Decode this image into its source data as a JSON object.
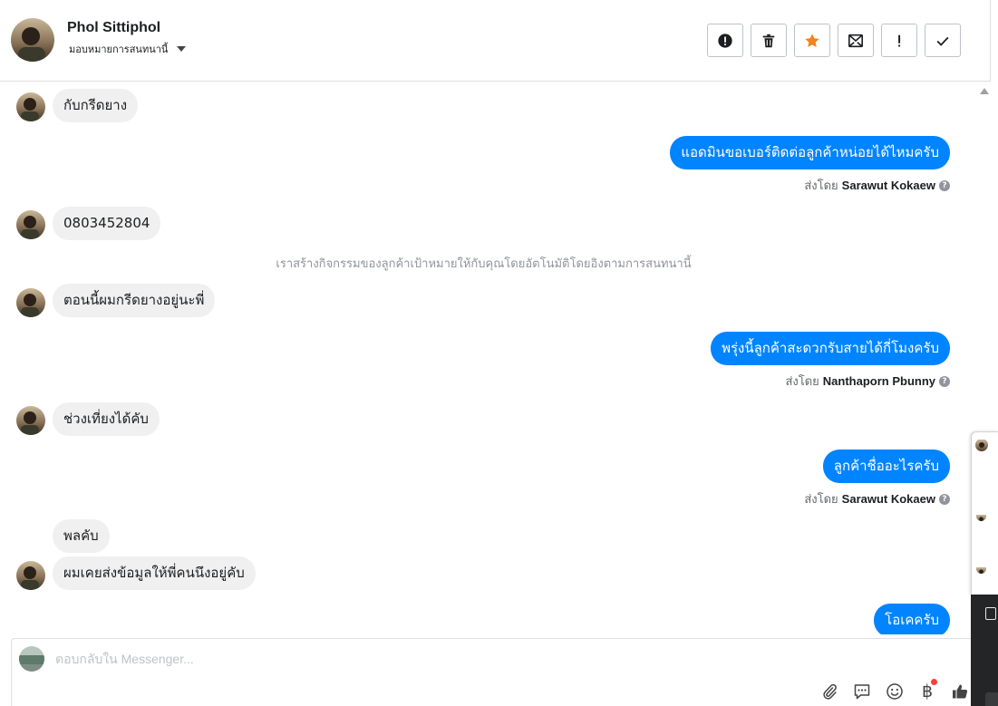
{
  "header": {
    "name": "Phol Sittiphol",
    "assign_label": "มอบหมายการสนทนานี้"
  },
  "toolbar": {
    "buttons": [
      {
        "name": "spam-button",
        "icon": "alert-circle-icon"
      },
      {
        "name": "delete-button",
        "icon": "trash-icon"
      },
      {
        "name": "star-button",
        "icon": "star-icon",
        "color": "#f5821f"
      },
      {
        "name": "mark-unread-button",
        "icon": "mail-icon"
      },
      {
        "name": "follow-up-button",
        "icon": "exclamation-icon"
      },
      {
        "name": "done-button",
        "icon": "check-icon"
      }
    ]
  },
  "messages": [
    {
      "from": "customer",
      "text": "กับกรีดยาง"
    },
    {
      "from": "page",
      "text": "แอดมินขอเบอร์ติดต่อลูกค้าหน่อยได้ไหมครับ",
      "sent_by_label": "ส่งโดย",
      "sender": "Sarawut Kokaew"
    },
    {
      "from": "customer",
      "text": "0803452804"
    },
    {
      "from": "system",
      "text": "เราสร้างกิจกรรมของลูกค้าเป้าหมายให้กับคุณโดยอัตโนมัติโดยอิงตามการสนทนานี้"
    },
    {
      "from": "customer",
      "text": "ตอนนี้ผมกรีดยางอยู่นะพี่"
    },
    {
      "from": "page",
      "text": "พรุ่งนี้ลูกค้าสะดวกรับสายได้กี่โมงครับ",
      "sent_by_label": "ส่งโดย",
      "sender": "Nanthaporn Pbunny"
    },
    {
      "from": "customer",
      "text": "ช่วงเที่ยงได้คับ"
    },
    {
      "from": "page",
      "text": "ลูกค้าชื่ออะไรครับ",
      "sent_by_label": "ส่งโดย",
      "sender": "Sarawut Kokaew"
    },
    {
      "from": "customer",
      "text": "พลคับ"
    },
    {
      "from": "customer",
      "text": "ผมเคยส่งข้อมูลให้พี่คนนึงอยู่คับ"
    },
    {
      "from": "page",
      "text": "โอเคครับ"
    }
  ],
  "composer": {
    "placeholder": "ตอบกลับใน Messenger...",
    "actions": [
      "paperclip-icon",
      "saved-reply-icon",
      "emoji-icon",
      "baht-payment-icon",
      "thumbs-up-icon"
    ],
    "baht_symbol": "฿"
  },
  "colors": {
    "outgoing_bubble": "#0084ff",
    "incoming_bubble": "#f0f0f0",
    "star": "#f5821f",
    "notification_dot": "#fa3e3e"
  }
}
